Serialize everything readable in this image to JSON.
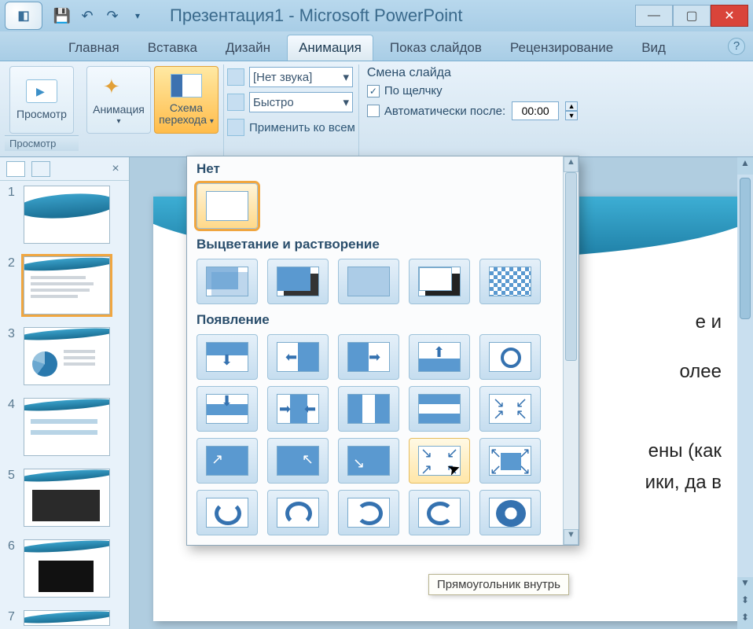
{
  "title": "Презентация1 - Microsoft PowerPoint",
  "tabs": {
    "home": "Главная",
    "insert": "Вставка",
    "design": "Дизайн",
    "animation": "Анимация",
    "slideshow": "Показ слайдов",
    "review": "Рецензирование",
    "view": "Вид"
  },
  "ribbon": {
    "preview_btn": "Просмотр",
    "preview_group": "Просмотр",
    "animation_btn": "Анимация",
    "scheme_btn_l1": "Схема",
    "scheme_btn_l2": "перехода",
    "sound": {
      "label": "[Нет звука]"
    },
    "speed": {
      "label": "Быстро"
    },
    "apply_all": "Применить ко всем",
    "advance_hdr": "Смена слайда",
    "on_click": "По щелчку",
    "on_click_checked": true,
    "auto_after": "Автоматически после:",
    "auto_after_checked": false,
    "time_value": "00:00"
  },
  "gallery": {
    "cat_none": "Нет",
    "cat_fade": "Выцветание и растворение",
    "cat_wipe": "Появление",
    "tooltip": "Прямоугольник внутрь"
  },
  "slide_body": {
    "line1_tail": "е и",
    "line2_tail": "олее",
    "line3_tail": "ены (как",
    "line4_tail": "ики, да в"
  },
  "thumbs": [
    "1",
    "2",
    "3",
    "4",
    "5",
    "6",
    "7"
  ]
}
